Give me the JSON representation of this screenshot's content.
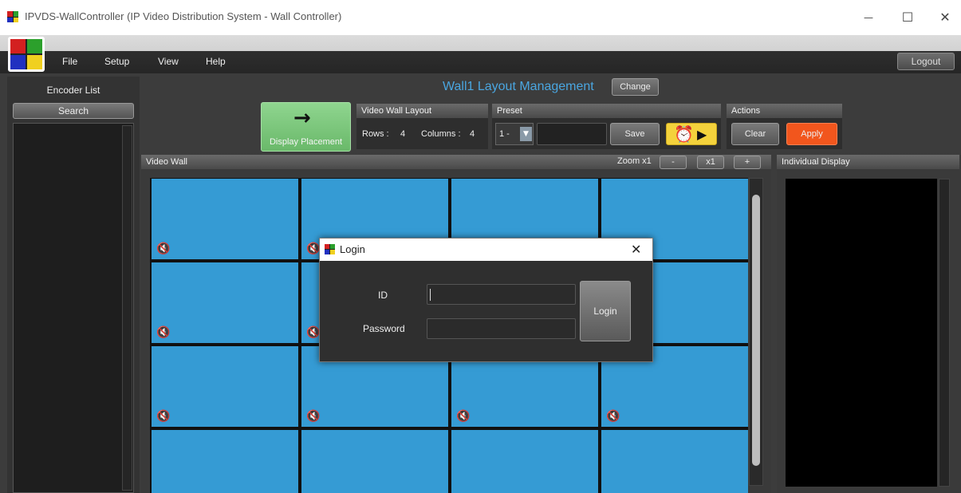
{
  "window": {
    "title": "IPVDS-WallController (IP Video Distribution System - Wall Controller)",
    "minimize_glyph": "—",
    "maximize_glyph": "☐",
    "close_glyph": "✕"
  },
  "menu": {
    "items": [
      "File",
      "Setup",
      "View",
      "Help"
    ],
    "logout_label": "Logout"
  },
  "encoder_list": {
    "title": "Encoder List",
    "search_label": "Search"
  },
  "layout_management": {
    "title": "Wall1 Layout Management",
    "change_label": "Change",
    "display_placement_label": "Display Placement",
    "video_wall_layout": {
      "title": "Video Wall Layout",
      "rows_label": "Rows :",
      "rows_value": "4",
      "columns_label": "Columns :",
      "columns_value": "4"
    },
    "preset": {
      "title": "Preset",
      "selected": "1 -",
      "save_label": "Save"
    },
    "actions": {
      "title": "Actions",
      "clear_label": "Clear",
      "apply_label": "Apply"
    }
  },
  "video_wall": {
    "title": "Video Wall",
    "zoom_label": "Zoom x1",
    "zoom_out_label": "-",
    "zoom_reset_label": "x1",
    "zoom_in_label": "+",
    "rows": 4,
    "columns": 4,
    "speaker_glyph": "🔇"
  },
  "individual_display": {
    "title": "Individual Display"
  },
  "login_dialog": {
    "title": "Login",
    "close_glyph": "✕",
    "id_label": "ID",
    "id_value": "",
    "password_label": "Password",
    "password_value": "",
    "login_label": "Login"
  },
  "colors": {
    "tile_blue": "#359bd4",
    "title_blue": "#4aa6e0",
    "apply_orange": "#f2561d",
    "placement_green": "#79c679",
    "alarm_yellow": "#f4d23c"
  },
  "icons": {
    "placement": "right-arrow-icon",
    "alarm": "alarm-clock-icon",
    "play": "play-icon",
    "mute": "speaker-muted-icon"
  }
}
